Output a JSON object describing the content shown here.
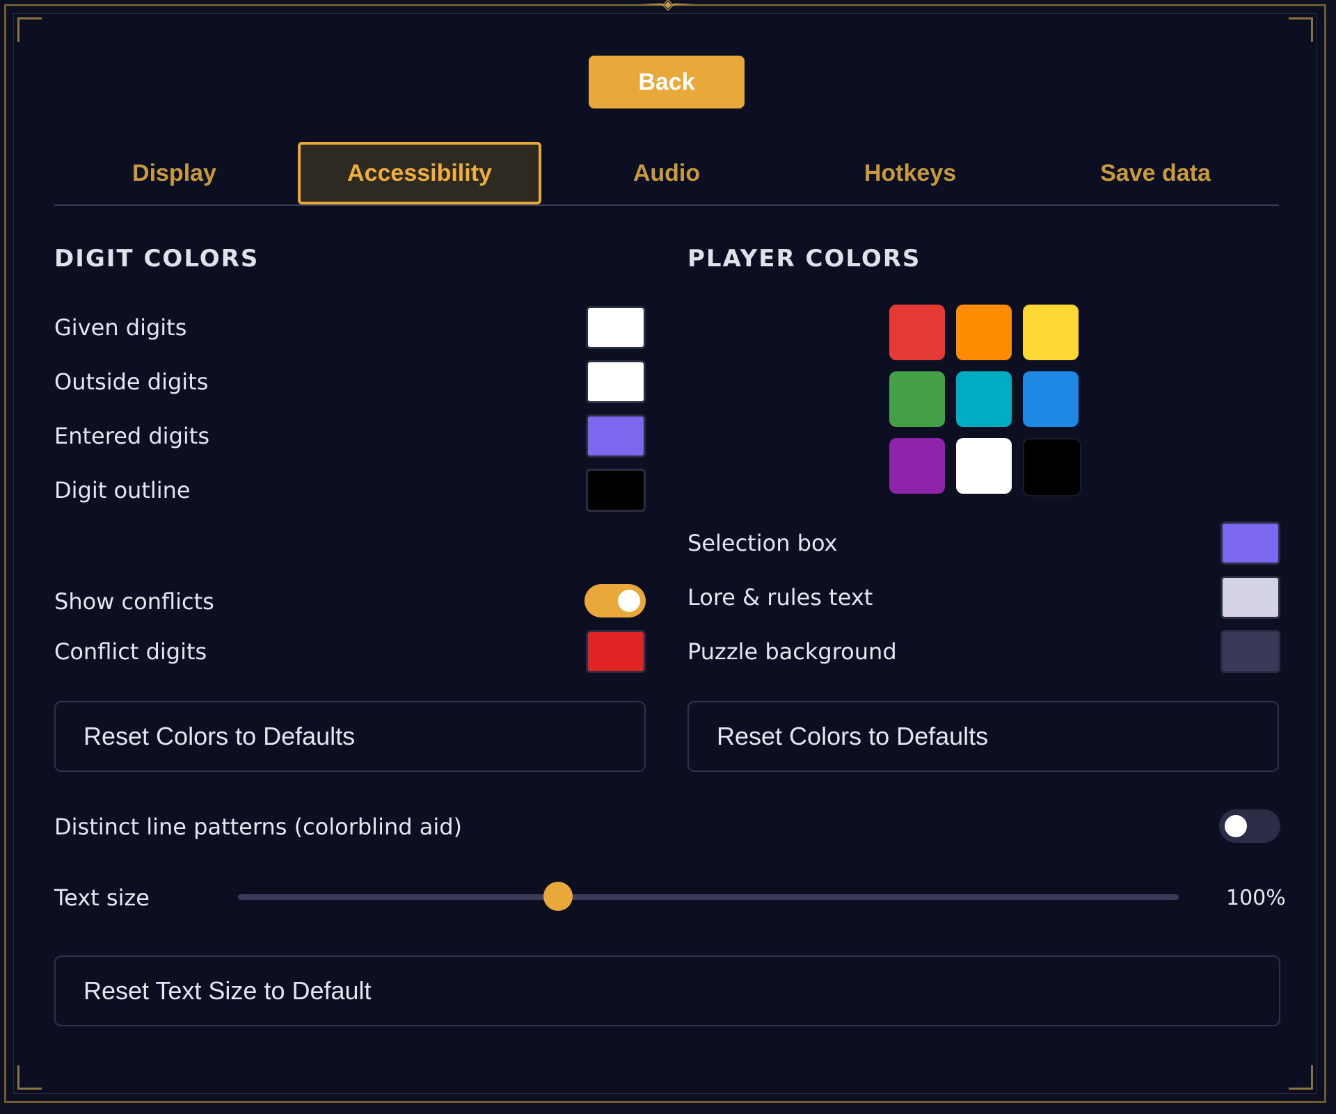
{
  "header": {
    "back_label": "Back"
  },
  "tabs": [
    {
      "label": "Display"
    },
    {
      "label": "Accessibility",
      "active": true
    },
    {
      "label": "Audio"
    },
    {
      "label": "Hotkeys"
    },
    {
      "label": "Save data"
    }
  ],
  "digit_colors": {
    "title": "DIGIT COLORS",
    "items": [
      {
        "label": "Given digits",
        "color": "#ffffff"
      },
      {
        "label": "Outside digits",
        "color": "#ffffff"
      },
      {
        "label": "Entered digits",
        "color": "#7b68ee"
      },
      {
        "label": "Digit outline",
        "color": "#000000"
      }
    ],
    "show_conflicts": {
      "label": "Show conflicts",
      "on": true
    },
    "conflict_digits": {
      "label": "Conflict digits",
      "color": "#e02424"
    },
    "reset_label": "Reset Colors to Defaults"
  },
  "player_colors": {
    "title": "PLAYER COLORS",
    "palette": [
      "#e53935",
      "#fb8c00",
      "#fdd835",
      "#43a047",
      "#00acc1",
      "#1e88e5",
      "#8e24aa",
      "#ffffff",
      "#000000"
    ],
    "items": [
      {
        "label": "Selection box",
        "color": "#7b68ee"
      },
      {
        "label": "Lore & rules text",
        "color": "#d4d4e4"
      },
      {
        "label": "Puzzle background",
        "color": "#3a3a58"
      }
    ],
    "reset_label": "Reset Colors to Defaults"
  },
  "colorblind": {
    "label": "Distinct line patterns (colorblind aid)",
    "on": false
  },
  "text_size": {
    "label": "Text size",
    "value_text": "100%",
    "fraction": 0.34
  },
  "reset_text_size_label": "Reset Text Size to Default",
  "colors": {
    "accent": "#e9a93a",
    "toggle_off": "#2a2d45"
  }
}
